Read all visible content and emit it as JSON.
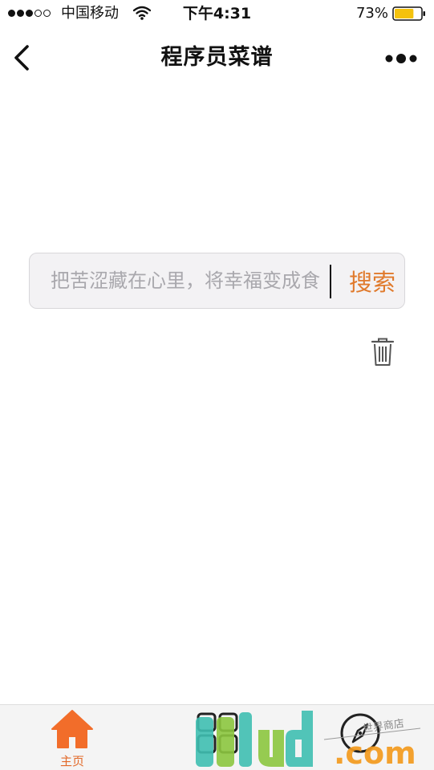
{
  "status_bar": {
    "carrier": "中国移动",
    "time": "下午4:31",
    "battery_percent": "73%",
    "battery_level": 0.73,
    "signal_bars_filled": 3,
    "signal_bars_total": 5
  },
  "nav": {
    "title": "程序员菜谱"
  },
  "search": {
    "placeholder": "把苦涩藏在心里，将幸福变成食",
    "value": "",
    "button_label": "搜索"
  },
  "tab_bar": {
    "tabs": [
      {
        "label": "主页",
        "icon": "home-icon",
        "active": true
      },
      {
        "label": "",
        "icon": "grid-icon",
        "active": false
      },
      {
        "label": "",
        "icon": "compass-icon",
        "active": false
      }
    ]
  },
  "watermark": {
    "logo_text": "3lud.com",
    "caption": "世界商店"
  },
  "colors": {
    "accent": "#e07a2c",
    "home_active": "#f26d2a",
    "placeholder": "#a9a8ad",
    "search_bg": "#f3f2f4",
    "tab_bar_bg": "#f4f4f4",
    "battery_fill": "#f4c20d",
    "logo_teal": "#3fbfb1",
    "logo_green": "#8cc63f",
    "logo_orange": "#f39a1e"
  }
}
